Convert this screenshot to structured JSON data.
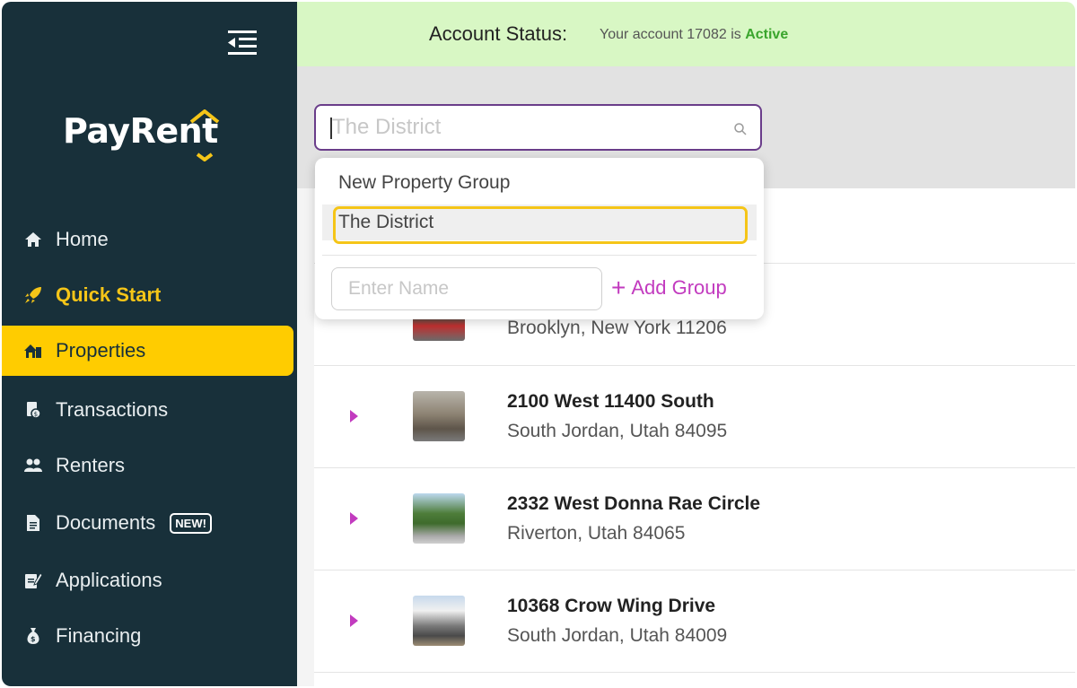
{
  "brand": {
    "name": "PayRent"
  },
  "sidebar": {
    "items": [
      {
        "label": "Home",
        "icon": "home-icon"
      },
      {
        "label": "Quick Start",
        "icon": "rocket-icon"
      },
      {
        "label": "Properties",
        "icon": "properties-icon"
      },
      {
        "label": "Transactions",
        "icon": "transactions-icon"
      },
      {
        "label": "Renters",
        "icon": "renters-icon"
      },
      {
        "label": "Documents",
        "icon": "document-icon",
        "badge": "NEW!"
      },
      {
        "label": "Applications",
        "icon": "applications-icon"
      },
      {
        "label": "Financing",
        "icon": "money-bag-icon"
      }
    ],
    "active": "Properties"
  },
  "status": {
    "label": "Account Status:",
    "text_prefix": "Your account 17082 is",
    "state": "Active"
  },
  "search": {
    "placeholder": "The District",
    "value": ""
  },
  "dropdown": {
    "items": [
      "New Property Group",
      "The District"
    ],
    "selected": "The District",
    "name_placeholder": "Enter Name",
    "add_label": "Add Group"
  },
  "properties": [
    {
      "address": "",
      "city": "Brooklyn, New York 11206"
    },
    {
      "address": "2100 West 11400 South",
      "city": "South Jordan, Utah 84095"
    },
    {
      "address": "2332 West Donna Rae Circle",
      "city": "Riverton, Utah 84065"
    },
    {
      "address": "10368 Crow Wing Drive",
      "city": "South Jordan, Utah 84009"
    }
  ],
  "colors": {
    "sidebar": "#18303a",
    "accent_yellow": "#ffcc00",
    "status_bg": "#d8f7c4",
    "active_green": "#3aa52d",
    "magenta": "#c23bbf",
    "search_border": "#6a3d8a"
  }
}
